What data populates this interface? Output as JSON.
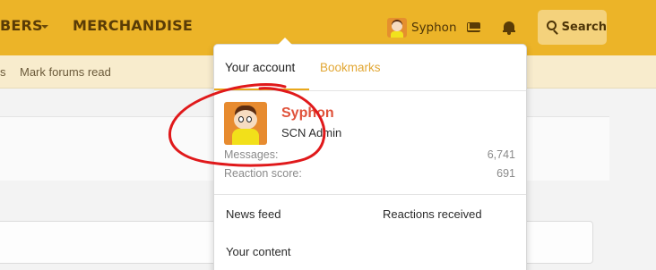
{
  "nav": {
    "members_fragment": "BERS",
    "merchandise": "MERCHANDISE",
    "user_name": "Syphon",
    "search_label": "Search"
  },
  "subnav": {
    "fragment": "s",
    "mark_read": "Mark forums read"
  },
  "popup": {
    "tabs": [
      "Your account",
      "Bookmarks"
    ],
    "active_tab": "Your account",
    "profile": {
      "name": "Syphon",
      "role": "SCN Admin"
    },
    "stats": [
      {
        "label": "Messages:",
        "value": "6,741"
      },
      {
        "label": "Reaction score:",
        "value": "691"
      }
    ],
    "links": [
      "News feed",
      "Reactions received",
      "Your content"
    ]
  },
  "colors": {
    "accent": "#ecb428",
    "username": "#e0523a",
    "annotation": "#e0191b"
  },
  "icons": [
    "user-avatar",
    "mail-icon",
    "bell-icon",
    "search-icon",
    "dropdown-caret-icon"
  ]
}
